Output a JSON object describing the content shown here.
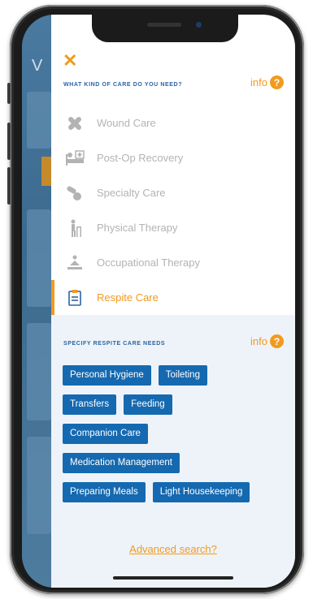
{
  "panel": {
    "close_icon": "close-icon",
    "care_heading": "WHAT KIND OF CARE DO YOU NEED?",
    "info_label": "info",
    "info_badge": "?",
    "care_types": [
      {
        "label": "Wound Care",
        "icon": "bandage-icon",
        "selected": false
      },
      {
        "label": "Post-Op Recovery",
        "icon": "patient-bed-icon",
        "selected": false
      },
      {
        "label": "Specialty Care",
        "icon": "pills-icon",
        "selected": false
      },
      {
        "label": "Physical Therapy",
        "icon": "walker-person-icon",
        "selected": false
      },
      {
        "label": "Occupational Therapy",
        "icon": "therapy-person-icon",
        "selected": false
      },
      {
        "label": "Respite Care",
        "icon": "clipboard-icon",
        "selected": true
      }
    ],
    "needs_heading": "SPECIFY RESPITE CARE NEEDS",
    "needs": [
      [
        "Personal Hygiene",
        "Toileting"
      ],
      [
        "Transfers",
        "Feeding"
      ],
      [
        "Companion Care"
      ],
      [
        "Medication Management"
      ],
      [
        "Preparing Meals",
        "Light Housekeeping"
      ]
    ],
    "advanced_search": "Advanced search?"
  },
  "background_app": {
    "title_letter": "V"
  },
  "colors": {
    "accent": "#f29a1f",
    "chip": "#1569b0",
    "heading": "#2b63a3",
    "muted": "#b3b3b3"
  }
}
